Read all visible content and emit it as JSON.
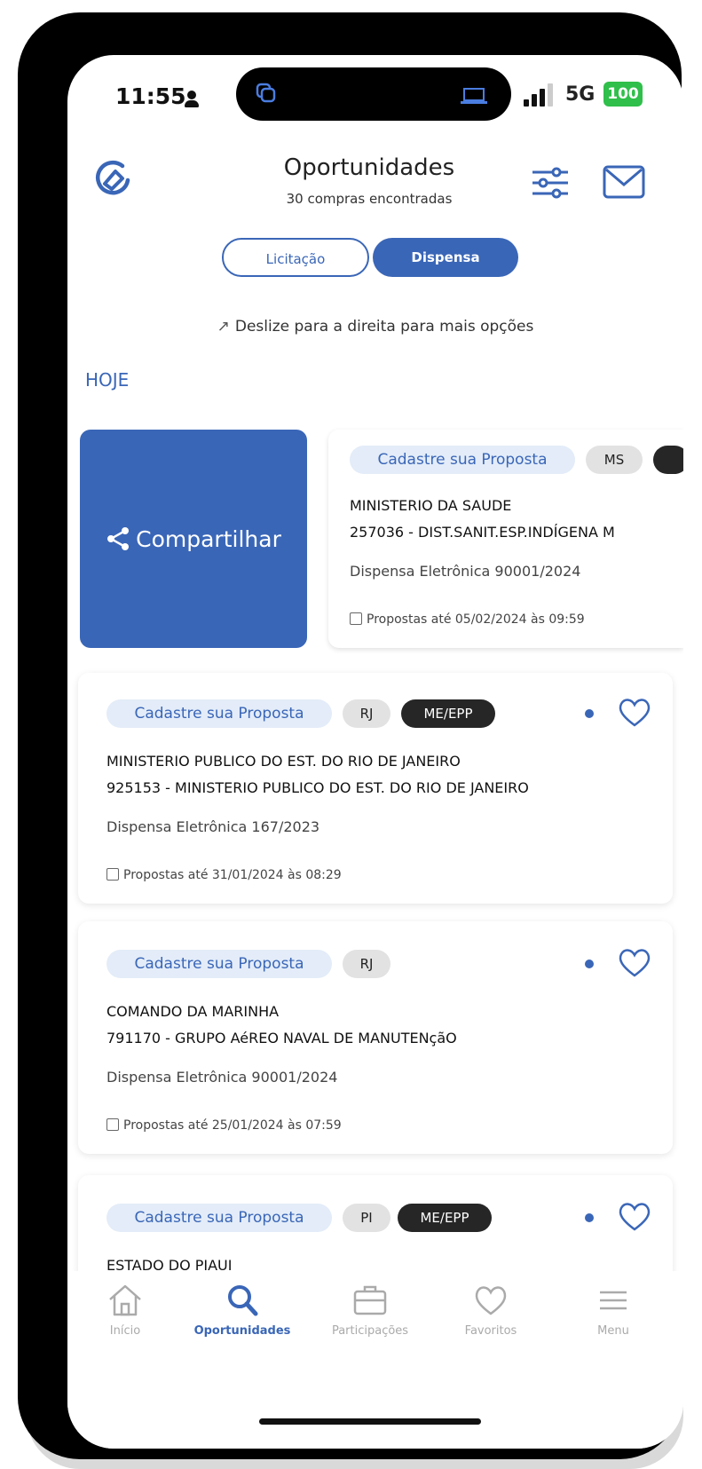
{
  "status_bar": {
    "time": "11:55",
    "network": "5G",
    "battery": "100"
  },
  "header": {
    "title": "Oportunidades",
    "subtitle": "30 compras encontradas"
  },
  "segment": {
    "option1": "Licitação",
    "option2": "Dispensa",
    "selected": "Dispensa"
  },
  "hint": "Deslize para a direita para mais opções",
  "section": "HOJE",
  "share_action": "Compartilhar",
  "cards": [
    {
      "tag": "Cadastre sua Proposta",
      "uf": "MS",
      "org": "MINISTERIO DA SAUDE",
      "unit": "257036 - DIST.SANIT.ESP.INDÍGENA M",
      "modality": "Dispensa Eletrônica 90001/2024",
      "deadline": "Propostas até 05/02/2024 às 09:59"
    },
    {
      "tag": "Cadastre sua Proposta",
      "uf": "RJ",
      "badge": "ME/EPP",
      "org": "MINISTERIO PUBLICO DO EST. DO RIO DE JANEIRO",
      "unit": "925153 - MINISTERIO PUBLICO DO EST. DO RIO DE JANEIRO",
      "modality": "Dispensa Eletrônica 167/2023",
      "deadline": "Propostas até 31/01/2024 às 08:29"
    },
    {
      "tag": "Cadastre sua Proposta",
      "uf": "RJ",
      "org": "COMANDO DA MARINHA",
      "unit": "791170 - GRUPO AéREO NAVAL DE MANUTENçãO",
      "modality": "Dispensa Eletrônica 90001/2024",
      "deadline": "Propostas até 25/01/2024 às 07:59"
    },
    {
      "tag": "Cadastre sua Proposta",
      "uf": "PI",
      "badge": "ME/EPP",
      "org": "ESTADO DO PIAUI"
    }
  ],
  "nav": [
    "Início",
    "Oportunidades",
    "Participações",
    "Favoritos",
    "Menu"
  ],
  "colors": {
    "primary": "#3a66b7",
    "badge_dark": "#262626",
    "battery": "#2fbf4a"
  }
}
